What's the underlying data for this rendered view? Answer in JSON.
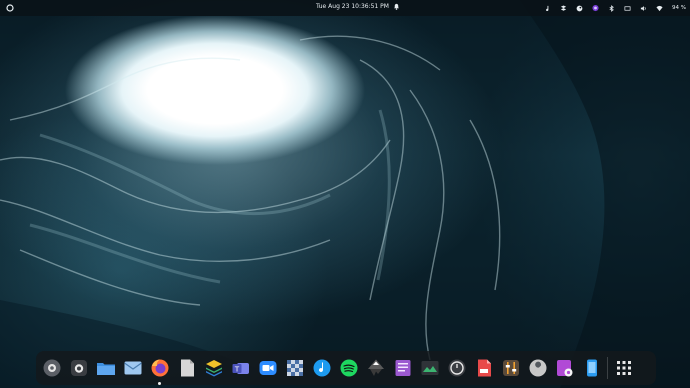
{
  "topbar": {
    "activities_icon": "circle-icon",
    "datetime": "Tue Aug 23  10:36:51 PM",
    "notification_icon": "bell-icon",
    "tray_icons": [
      "music-icon",
      "dropbox-icon",
      "steam-icon",
      "purple-circle-icon",
      "bluetooth-icon",
      "network-icon",
      "volume-icon",
      "wifi-icon"
    ],
    "battery": "94 %"
  },
  "dock": {
    "apps": [
      {
        "name": "Settings",
        "icon": "settings-icon"
      },
      {
        "name": "Screenshot",
        "icon": "camera-icon"
      },
      {
        "name": "Files",
        "icon": "folder-icon"
      },
      {
        "name": "Mail",
        "icon": "mail-icon"
      },
      {
        "name": "Firefox",
        "icon": "firefox-icon"
      },
      {
        "name": "Document",
        "icon": "document-icon"
      },
      {
        "name": "Layers",
        "icon": "layers-icon"
      },
      {
        "name": "Teams",
        "icon": "teams-icon"
      },
      {
        "name": "Zoom",
        "icon": "zoom-icon"
      },
      {
        "name": "Checkerboard",
        "icon": "checker-icon"
      },
      {
        "name": "Music",
        "icon": "music-note-icon"
      },
      {
        "name": "Spotify",
        "icon": "spotify-icon"
      },
      {
        "name": "Inkscape",
        "icon": "inkscape-icon"
      },
      {
        "name": "Notes",
        "icon": "notes-icon"
      },
      {
        "name": "Monitor",
        "icon": "monitor-icon"
      },
      {
        "name": "Timer",
        "icon": "timer-icon"
      },
      {
        "name": "PDF",
        "icon": "pdf-icon"
      },
      {
        "name": "Tweaks",
        "icon": "tweaks-icon"
      },
      {
        "name": "Utility",
        "icon": "wrench-icon"
      },
      {
        "name": "Media",
        "icon": "media-icon"
      },
      {
        "name": "Phone",
        "icon": "phone-icon"
      },
      {
        "name": "Show Apps",
        "icon": "grid-icon"
      }
    ],
    "running": [
      "Firefox"
    ]
  }
}
